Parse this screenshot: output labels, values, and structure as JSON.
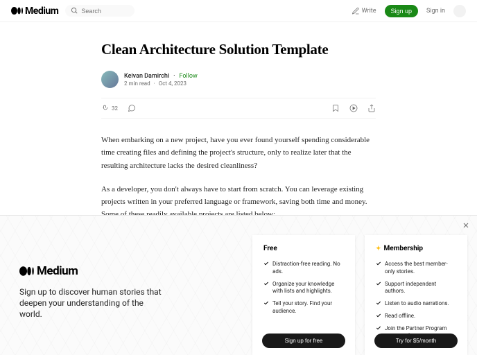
{
  "header": {
    "search_placeholder": "Search",
    "write_label": "Write",
    "signup_label": "Sign up",
    "signin_label": "Sign in"
  },
  "article": {
    "title": "Clean Architecture Solution Template",
    "author": "Keivan Damirchi",
    "follow_label": "Follow",
    "read_time": "2 min read",
    "date": "Oct 4, 2023",
    "clap_count": "32",
    "paragraphs": [
      "When embarking on a new project, have you ever found yourself spending considerable time creating files and defining the project's structure, only to realize later that the resulting architecture lacks the desired cleanliness?",
      "As a developer, you don't always have to start from scratch. You can leverage existing projects written in your preferred language or framework, saving both time and money. Some of these readily available projects are listed below:"
    ]
  },
  "overlay": {
    "brand": "Medium",
    "tagline": "Sign up to discover human stories that deepen your understanding of the world.",
    "free": {
      "title": "Free",
      "benefits": [
        "Distraction-free reading. No ads.",
        "Organize your knowledge with lists and highlights.",
        "Tell your story. Find your audience."
      ],
      "button": "Sign up for free"
    },
    "member": {
      "title": "Membership",
      "benefits": [
        "Access the best member-only stories.",
        "Support independent authors.",
        "Listen to audio narrations.",
        "Read offline.",
        "Join the Partner Program and earn for your writing."
      ],
      "button": "Try for $5/month"
    }
  }
}
